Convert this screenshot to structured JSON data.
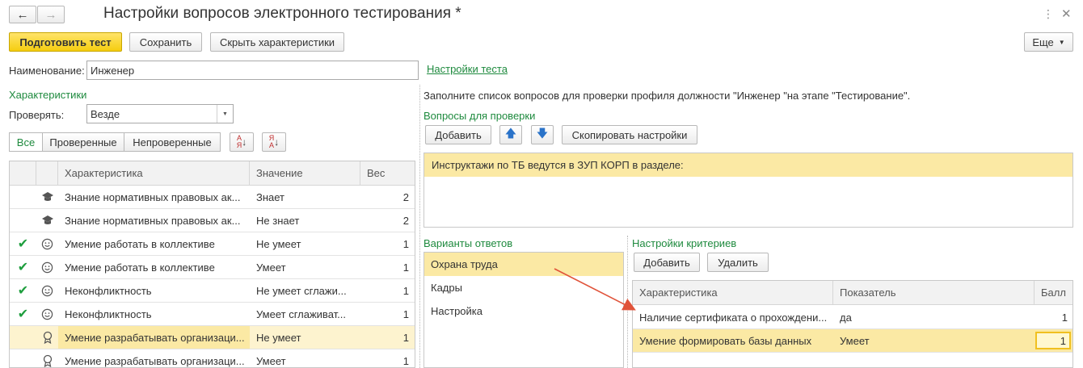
{
  "window": {
    "title": "Настройки вопросов электронного тестирования *"
  },
  "toolbar": {
    "prepare_label": "Подготовить тест",
    "save_label": "Сохранить",
    "hide_label": "Скрыть характеристики",
    "more_label": "Еще"
  },
  "form": {
    "name_label": "Наименование:",
    "name_value": "Инженер",
    "test_settings_link": "Настройки теста",
    "characteristics_title": "Характеристики",
    "check_label": "Проверять:",
    "check_value": "Везде"
  },
  "filters": {
    "all": "Все",
    "checked": "Проверенные",
    "unchecked": "Непроверенные"
  },
  "char_table": {
    "columns": [
      "Характеристика",
      "Значение",
      "Вес"
    ],
    "rows": [
      {
        "check": "",
        "icon": "graduation-cap-icon",
        "name": "Знание нормативных правовых ак...",
        "value": "Знает",
        "weight": "2"
      },
      {
        "check": "",
        "icon": "graduation-cap-icon",
        "name": "Знание нормативных правовых ак...",
        "value": "Не знает",
        "weight": "2"
      },
      {
        "check": "✔",
        "icon": "smiley-icon",
        "name": "Умение работать в коллективе",
        "value": "Не умеет",
        "weight": "1"
      },
      {
        "check": "✔",
        "icon": "smiley-icon",
        "name": "Умение работать в коллективе",
        "value": "Умеет",
        "weight": "1"
      },
      {
        "check": "✔",
        "icon": "smiley-icon",
        "name": "Неконфликтность",
        "value": "Не умеет сглажи...",
        "weight": "1"
      },
      {
        "check": "✔",
        "icon": "smiley-icon",
        "name": "Неконфликтность",
        "value": "Умеет сглаживат...",
        "weight": "1"
      },
      {
        "check": "",
        "icon": "award-icon",
        "name": "Умение разрабатывать организаци...",
        "value": "Не умеет",
        "weight": "1"
      },
      {
        "check": "",
        "icon": "award-icon",
        "name": "Умение разрабатывать организаци...",
        "value": "Умеет",
        "weight": "1"
      }
    ]
  },
  "right": {
    "info_text": "Заполните список вопросов для проверки профиля должности \"Инженер \"на этапе \"Тестирование\".",
    "questions_title": "Вопросы для проверки",
    "add_label": "Добавить",
    "copy_label": "Скопировать настройки",
    "question_text": "Инструктажи по ТБ ведутся в ЗУП КОРП в разделе:",
    "answers_title": "Варианты ответов",
    "answers": [
      "Охрана труда",
      "Кадры",
      "Настройка"
    ],
    "criteria_title": "Настройки критериев",
    "criteria_add": "Добавить",
    "criteria_delete": "Удалить",
    "criteria_columns": [
      "Характеристика",
      "Показатель",
      "Балл"
    ],
    "criteria_rows": [
      {
        "name": "Наличие сертификата о прохождени...",
        "indicator": "да",
        "score": "1"
      },
      {
        "name": "Умение формировать базы данных",
        "indicator": "Умеет",
        "score": "1"
      }
    ]
  },
  "colors": {
    "accent_green": "#1e8a3e",
    "primary_yellow": "#f5cd0f",
    "selection": "#fbe9a4",
    "arrow": "#e0533a"
  }
}
